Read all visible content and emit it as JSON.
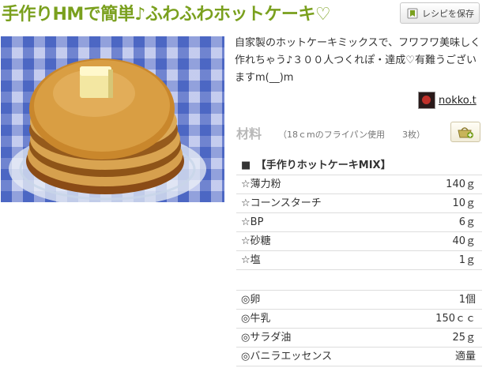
{
  "recipe": {
    "title": "手作りHMで簡単♪ふわふわホットケーキ♡",
    "save_label": "レシピを保存",
    "description": "自家製のホットケーキミックスで、フワフワ美味しく作れちゃう♪３００人つくれぽ・達成♡有難うございますm(__)m",
    "author": "nokko.t"
  },
  "ingredients": {
    "heading": "材料",
    "note": "（18ｃmのフライパン使用　　3枚）",
    "group_title": "■　【手作りホットケーキMIX】",
    "group_items": [
      {
        "name": "☆薄力粉",
        "qty": "140ｇ"
      },
      {
        "name": "☆コーンスターチ",
        "qty": "10ｇ"
      },
      {
        "name": "☆BP",
        "qty": "6ｇ"
      },
      {
        "name": "☆砂糖",
        "qty": "40ｇ"
      },
      {
        "name": "☆塩",
        "qty": "1ｇ"
      }
    ],
    "other_items": [
      {
        "name": "◎卵",
        "qty": "1個"
      },
      {
        "name": "◎牛乳",
        "qty": "150ｃｃ"
      },
      {
        "name": "◎サラダ油",
        "qty": "25ｇ"
      },
      {
        "name": "◎バニラエッセンス",
        "qty": "適量"
      }
    ]
  },
  "icons": {
    "save": "bookmark-icon",
    "cart": "basket-icon"
  }
}
